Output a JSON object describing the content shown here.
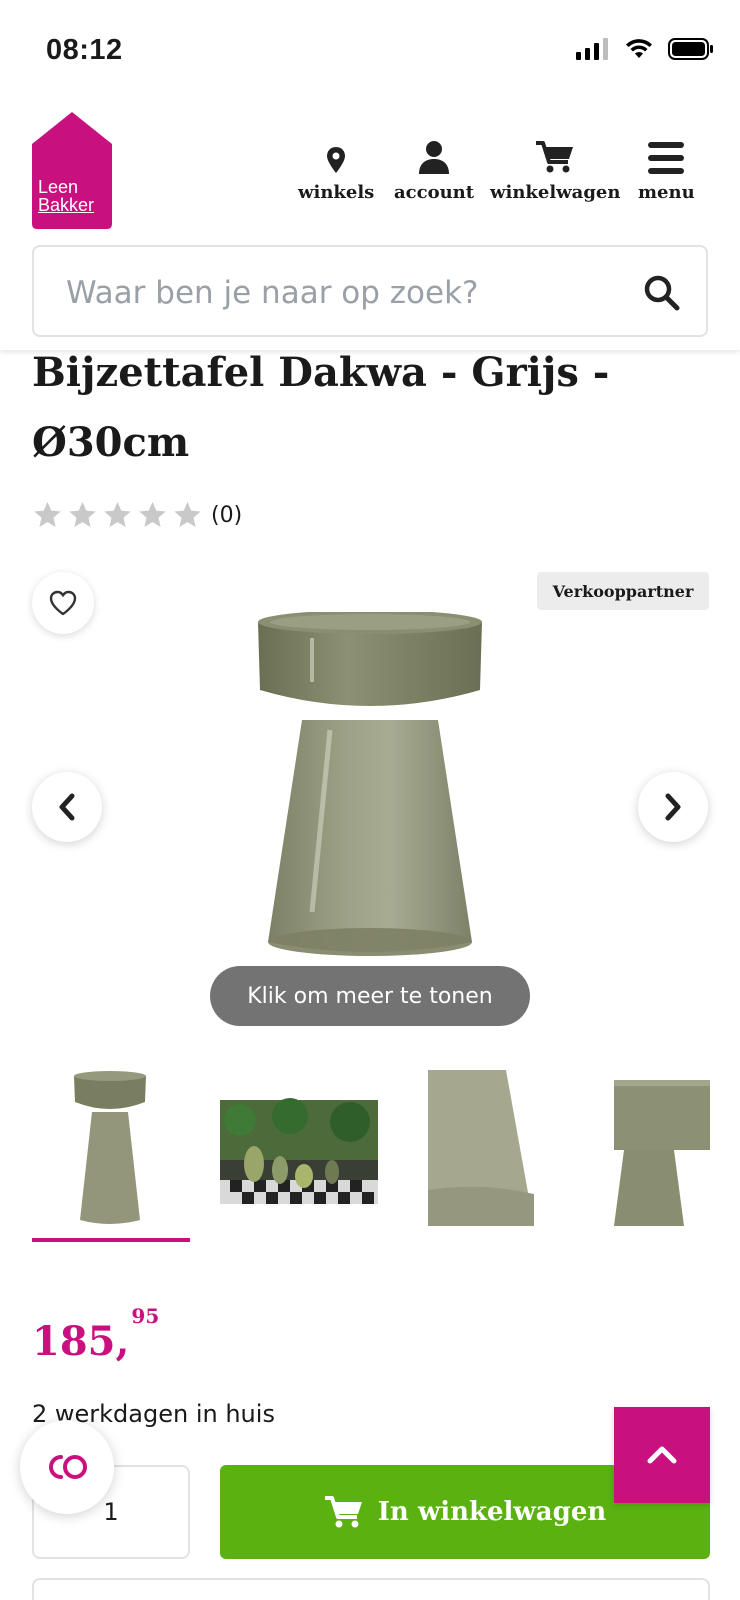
{
  "status_bar": {
    "time": "08:12"
  },
  "brand": {
    "name": "Leen Bakker",
    "line1": "Leen",
    "line2": "Bakker",
    "color": "#c8117f"
  },
  "nav": {
    "stores": "winkels",
    "account": "account",
    "cart": "winkelwagen",
    "menu": "menu"
  },
  "search": {
    "placeholder": "Waar ben je naar op zoek?",
    "value": ""
  },
  "product": {
    "title": "Bijzettafel Dakwa - Grijs - Ø30cm",
    "rating_count": "(0)",
    "stars_filled": 0,
    "stars_total": 5,
    "partner_badge": "Verkooppartner",
    "show_more": "Klik om meer te tonen",
    "price_main": "185,",
    "price_cents": "95",
    "delivery": "2 werkdagen in huis",
    "quantity": "1",
    "add_to_cart": "In winkelwagen"
  },
  "colors": {
    "accent": "#c8117f",
    "cta": "#5ab10f",
    "star": "#c9c9c9"
  }
}
